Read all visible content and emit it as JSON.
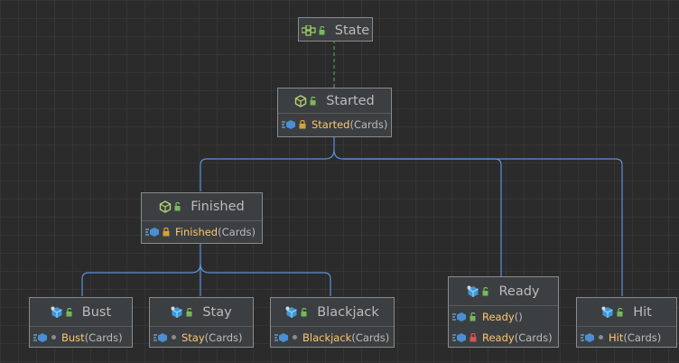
{
  "nodes": {
    "state": {
      "name": "State",
      "kind": "interface"
    },
    "started": {
      "name": "Started",
      "kind": "abstract-class",
      "methods": [
        {
          "name": "Started",
          "args": "(Cards)",
          "visibility": "protected"
        }
      ]
    },
    "finished": {
      "name": "Finished",
      "kind": "abstract-class",
      "methods": [
        {
          "name": "Finished",
          "args": "(Cards)",
          "visibility": "protected"
        }
      ]
    },
    "bust": {
      "name": "Bust",
      "kind": "class",
      "methods": [
        {
          "name": "Bust",
          "args": "(Cards)",
          "visibility": "package"
        }
      ]
    },
    "stay": {
      "name": "Stay",
      "kind": "class",
      "methods": [
        {
          "name": "Stay",
          "args": "(Cards)",
          "visibility": "package"
        }
      ]
    },
    "blackjack": {
      "name": "Blackjack",
      "kind": "class",
      "methods": [
        {
          "name": "Blackjack",
          "args": "(Cards)",
          "visibility": "package"
        }
      ]
    },
    "ready": {
      "name": "Ready",
      "kind": "class",
      "methods": [
        {
          "name": "Ready",
          "args": "()",
          "visibility": "public"
        },
        {
          "name": "Ready",
          "args": "(Cards)",
          "visibility": "private"
        }
      ]
    },
    "hit": {
      "name": "Hit",
      "kind": "class",
      "methods": [
        {
          "name": "Hit",
          "args": "(Cards)",
          "visibility": "package"
        }
      ]
    }
  },
  "colors": {
    "background": "#2b2b2b",
    "node_fill": "#3c3f41",
    "node_border": "#8a8a8a",
    "method_name": "#ffc66d",
    "inheritance_edge": "#5b91d9",
    "implementation_edge": "#4f9a53"
  },
  "icons": {
    "interface": "interface-icon",
    "abstract-class": "abstract-class-icon",
    "class": "class-icon",
    "visibility": "open-lock-icon",
    "protected": "protected-lock-icon",
    "private": "red-lock-icon",
    "package": "package-dot-icon",
    "public": "open-lock-icon"
  }
}
